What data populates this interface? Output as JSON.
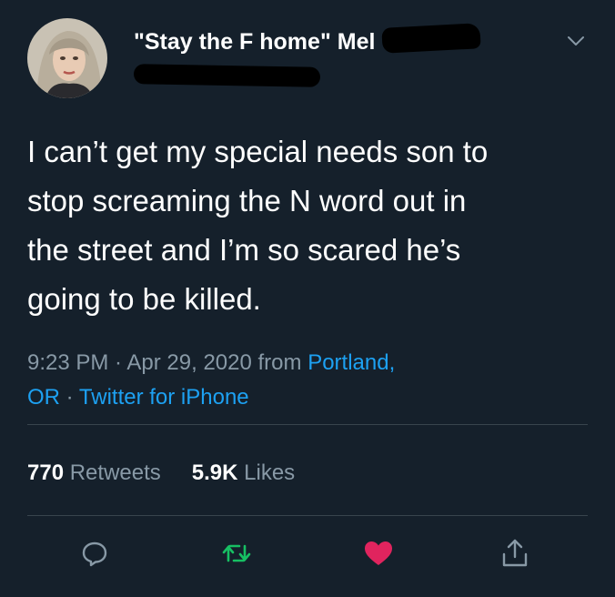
{
  "user": {
    "display_name": "\"Stay the F home\" Mel",
    "avatar": "profile-photo"
  },
  "tweet": {
    "lines": [
      "I can’t get my special needs son to",
      "stop screaming the N word out in",
      "the street and I’m so scared he’s",
      "going to be killed."
    ]
  },
  "meta": {
    "time": "9:23 PM",
    "sep1": " · ",
    "date": "Apr 29, 2020",
    "from": " from ",
    "location_part1": "Portland,",
    "location_part2": "OR",
    "sep2": " · ",
    "source": "Twitter for iPhone"
  },
  "stats": {
    "retweets_count": "770",
    "retweets_label": "Retweets",
    "likes_count": "5.9K",
    "likes_label": "Likes"
  },
  "actions": {
    "reply_icon": "reply-icon",
    "retweet_icon": "retweet-icon",
    "like_icon": "heart-icon",
    "share_icon": "share-icon"
  },
  "colors": {
    "background": "#15202b",
    "text": "#ffffff",
    "secondary": "#8899a6",
    "link": "#1da1f2",
    "retweet": "#17bf63",
    "like": "#e0245e"
  }
}
